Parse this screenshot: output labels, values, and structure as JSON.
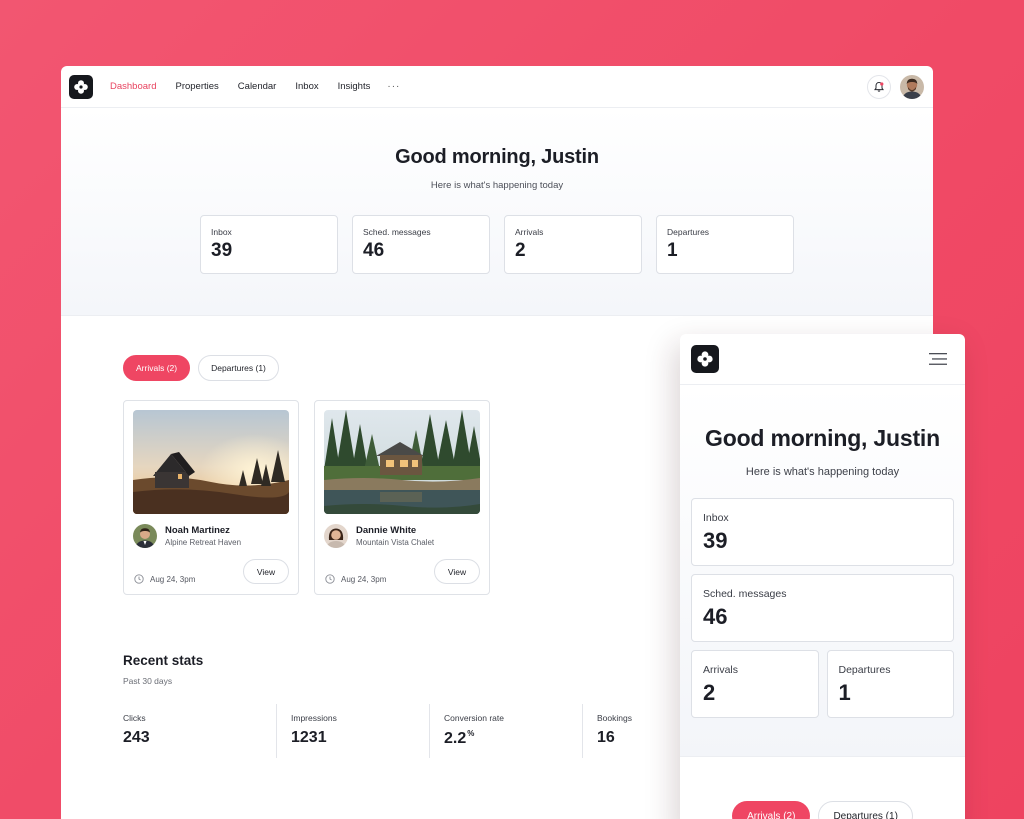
{
  "nav": {
    "items": [
      {
        "label": "Dashboard",
        "active": true
      },
      {
        "label": "Properties",
        "active": false
      },
      {
        "label": "Calendar",
        "active": false
      },
      {
        "label": "Inbox",
        "active": false
      },
      {
        "label": "Insights",
        "active": false
      }
    ],
    "more": "···"
  },
  "hero": {
    "greeting": "Good morning, Justin",
    "subtitle": "Here is what's happening today"
  },
  "stats": [
    {
      "label": "Inbox",
      "value": "39"
    },
    {
      "label": "Sched. messages",
      "value": "46"
    },
    {
      "label": "Arrivals",
      "value": "2"
    },
    {
      "label": "Departures",
      "value": "1"
    }
  ],
  "tabs": [
    {
      "label": "Arrivals (2)",
      "active": true
    },
    {
      "label": "Departures (1)",
      "active": false
    }
  ],
  "bookings": [
    {
      "guest": "Noah Martinez",
      "property": "Alpine Retreat Haven",
      "date": "Aug 24, 3pm",
      "action": "View"
    },
    {
      "guest": "Dannie White",
      "property": "Mountain Vista Chalet",
      "date": "Aug 24, 3pm",
      "action": "View"
    }
  ],
  "recent": {
    "title": "Recent stats",
    "period": "Past 30 days",
    "items": [
      {
        "label": "Clicks",
        "value": "243"
      },
      {
        "label": "Impressions",
        "value": "1231"
      },
      {
        "label": "Conversion rate",
        "value": "2.2",
        "unit": "%"
      },
      {
        "label": "Bookings",
        "value": "16"
      }
    ]
  },
  "colors": {
    "accent": "#ef4663",
    "background": "#f04a66",
    "text": "#1c1e26"
  },
  "icons": {
    "logo": "flower-logo-icon",
    "notifications": "bell-icon",
    "menu": "hamburger-menu-icon",
    "date": "clock-icon"
  }
}
